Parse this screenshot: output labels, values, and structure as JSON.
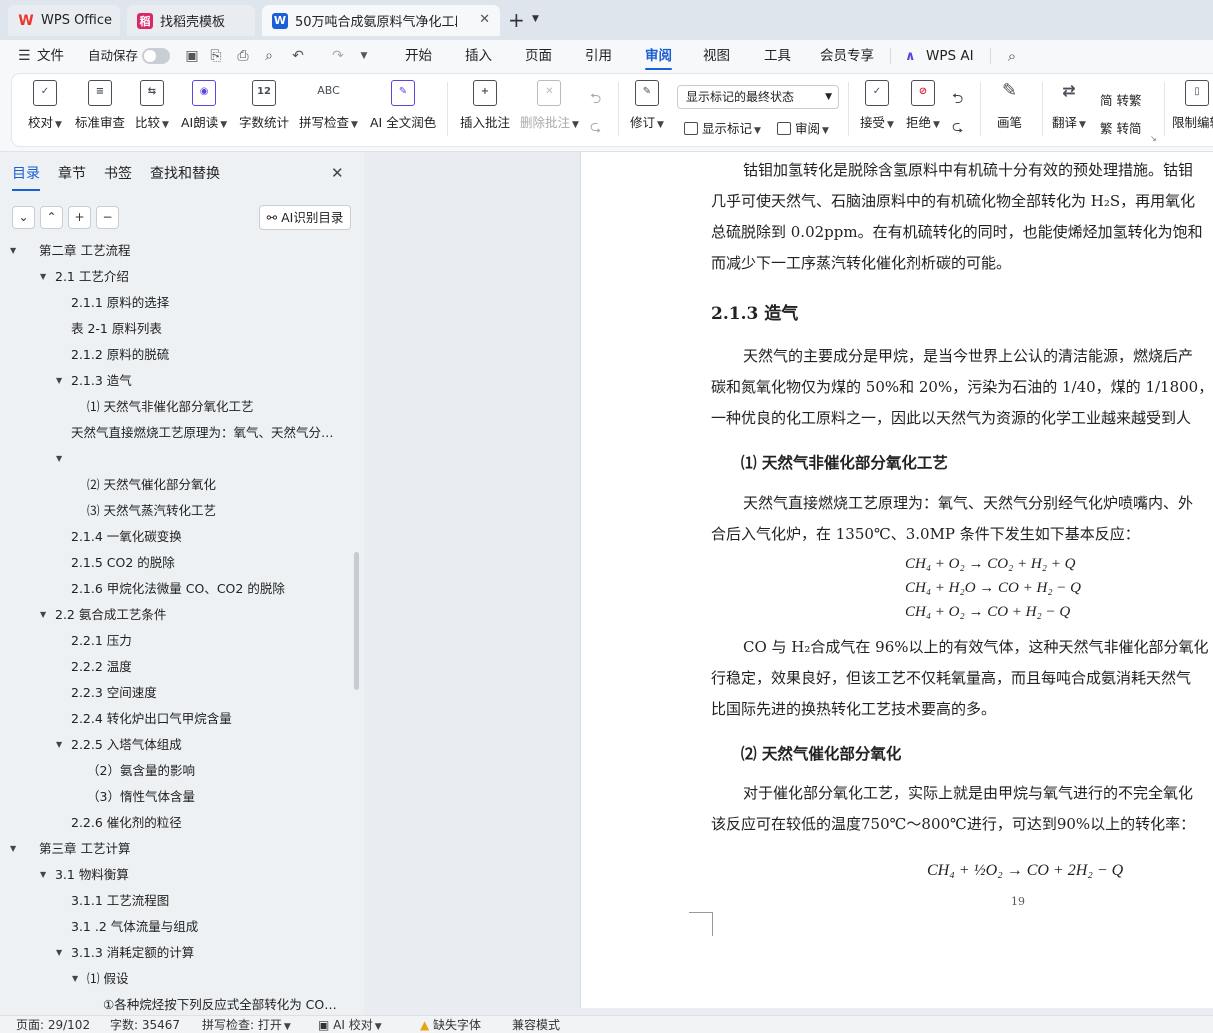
{
  "tabs": [
    {
      "label": "WPS Office",
      "icon": "wps-logo-icon",
      "color": "#e8382e"
    },
    {
      "label": "找稻壳模板",
      "icon": "docer-icon",
      "color": "#d9286a"
    },
    {
      "label": "50万吨合成氨原料气净化工段",
      "icon": "word-doc-icon",
      "color": "#1a5fd6"
    }
  ],
  "menubar": {
    "file": "文件",
    "autosave": "自动保存",
    "items": [
      "开始",
      "插入",
      "页面",
      "引用",
      "审阅",
      "视图",
      "工具",
      "会员专享"
    ],
    "active": "审阅",
    "wps_ai": "WPS AI"
  },
  "ribbon": {
    "proofread": "校对",
    "standard_review": "标准审查",
    "compare": "比较",
    "ai_read": "AI朗读",
    "word_count": "字数统计",
    "spell_check": "拼写检查",
    "ai_proofread": "AI 全文润色",
    "insert_comment": "插入批注",
    "delete_comment": "删除批注",
    "track_changes": "修订",
    "markup_select": "显示标记的最终状态",
    "show_markup": "显示标记",
    "review": "审阅",
    "accept": "接受",
    "reject": "拒绝",
    "ink": "画笔",
    "translate": "翻译",
    "to_traditional": "简 转繁",
    "to_simplified": "繁 转简",
    "restrict_edit": "限制编辑",
    "word_count_icon_text": "12",
    "spell_icon_text": "ABC"
  },
  "nav": {
    "tabs": [
      "目录",
      "章节",
      "书签",
      "查找和替换"
    ],
    "ai_toc": "AI识别目录",
    "items": [
      {
        "text": "第二章 工艺流程",
        "level": 0,
        "arrow": true
      },
      {
        "text": "2.1 工艺介绍",
        "level": 1,
        "arrow": true
      },
      {
        "text": "2.1.1 原料的选择",
        "level": 2,
        "arrow": false
      },
      {
        "text": "表 2-1  原料列表",
        "level": 2,
        "arrow": false
      },
      {
        "text": "2.1.2 原料的脱硫",
        "level": 2,
        "arrow": false
      },
      {
        "text": "2.1.3 造气",
        "level": 2,
        "arrow": true
      },
      {
        "text": "⑴ 天然气非催化部分氧化工艺",
        "level": 3,
        "arrow": false
      },
      {
        "text": "天然气直接燃烧工艺原理为：氧气、天然气分别经气化炉喷嘴内、外环...",
        "level": 2,
        "arrow": false
      },
      {
        "text": "",
        "level": 2,
        "arrow": true
      },
      {
        "text": "⑵  天然气催化部分氧化",
        "level": 3,
        "arrow": false
      },
      {
        "text": "⑶ 天然气蒸汽转化工艺",
        "level": 3,
        "arrow": false
      },
      {
        "text": "2.1.4 一氧化碳变换",
        "level": 2,
        "arrow": false
      },
      {
        "text": "2.1.5 CO2 的脱除",
        "level": 2,
        "arrow": false
      },
      {
        "text": "2.1.6 甲烷化法微量 CO、CO2 的脱除",
        "level": 2,
        "arrow": false
      },
      {
        "text": "2.2 氨合成工艺条件",
        "level": 1,
        "arrow": true
      },
      {
        "text": "2.2.1 压力",
        "level": 2,
        "arrow": false
      },
      {
        "text": "2.2.2 温度",
        "level": 2,
        "arrow": false
      },
      {
        "text": "2.2.3 空间速度",
        "level": 2,
        "arrow": false
      },
      {
        "text": "2.2.4 转化炉出口气甲烷含量",
        "level": 2,
        "arrow": false
      },
      {
        "text": "2.2.5 入塔气体组成",
        "level": 2,
        "arrow": true
      },
      {
        "text": "（2）氨含量的影响",
        "level": 3,
        "arrow": false
      },
      {
        "text": "（3）惰性气体含量",
        "level": 3,
        "arrow": false
      },
      {
        "text": "2.2.6 催化剂的粒径",
        "level": 2,
        "arrow": false
      },
      {
        "text": "第三章  工艺计算",
        "level": 0,
        "arrow": true
      },
      {
        "text": "3.1 物料衡算",
        "level": 1,
        "arrow": true
      },
      {
        "text": "3.1.1 工艺流程图",
        "level": 2,
        "arrow": false
      },
      {
        "text": "3.1 .2 气体流量与组成",
        "level": 2,
        "arrow": false
      },
      {
        "text": "3.1.3 消耗定额的计算",
        "level": 2,
        "arrow": true
      },
      {
        "text": "⑴ 假设",
        "level": 3,
        "arrow": true
      },
      {
        "text": "①各种烷烃按下列反应式全部转化为 CO2 和 H2...",
        "level": 4,
        "arrow": false
      }
    ]
  },
  "doc": {
    "p1": [
      "钴钼加氢转化是脱除含氢原料中有机硫十分有效的预处理措施。钴钼",
      "几乎可使天然气、石脑油原料中的有机硫化物全部转化为 H₂S，再用氧化",
      "总硫脱除到 0.02ppm。在有机硫转化的同时，也能使烯烃加氢转化为饱和",
      "而减少下一工序蒸汽转化催化剂析碳的可能。"
    ],
    "h213": "2.1.3 造气",
    "p2": [
      "天然气的主要成分是甲烷，是当今世界上公认的清洁能源，燃烧后产",
      "碳和氮氧化物仅为煤的 50%和 20%，污染为石油的 1/40，煤的 1/1800，可",
      "一种优良的化工原料之一，因此以天然气为资源的化学工业越来越受到人"
    ],
    "sub1": "⑴ 天然气非催化部分氧化工艺",
    "p3": [
      "天然气直接燃烧工艺原理为：氧气、天然气分别经气化炉喷嘴内、外",
      "合后入气化炉，在 1350℃、3.0MP 条件下发生如下基本反应："
    ],
    "eqs": [
      "CH₄ + O₂ → CO₂ + H₂ + Q",
      "CH₄ + H₂O → CO + H₂ − Q",
      "CH₄ + O₂ → CO + H₂ − Q"
    ],
    "p4": [
      "CO 与 H₂合成气在 96%以上的有效气体，这种天然气非催化部分氧化",
      "行稳定，效果良好，但该工艺不仅耗氧量高，而且每吨合成氨消耗天然气",
      "比国际先进的换热转化工艺技术要高的多。"
    ],
    "sub2": "⑵  天然气催化部分氧化",
    "p5": [
      "对于催化部分氧化工艺，实际上就是由甲烷与氧气进行的不完全氧化",
      "该反应可在较低的温度750℃～800℃进行，可达到90%以上的转化率："
    ],
    "eq_last": "CH₄ + ½O₂ → CO + 2H₂ − Q",
    "page_number": "19"
  },
  "status": {
    "page": "页面: 29/102",
    "words": "字数: 35467",
    "spell": "拼写检查: 打开",
    "ai_proof": "AI 校对",
    "missing_font": "缺失字体",
    "compat": "兼容模式"
  }
}
